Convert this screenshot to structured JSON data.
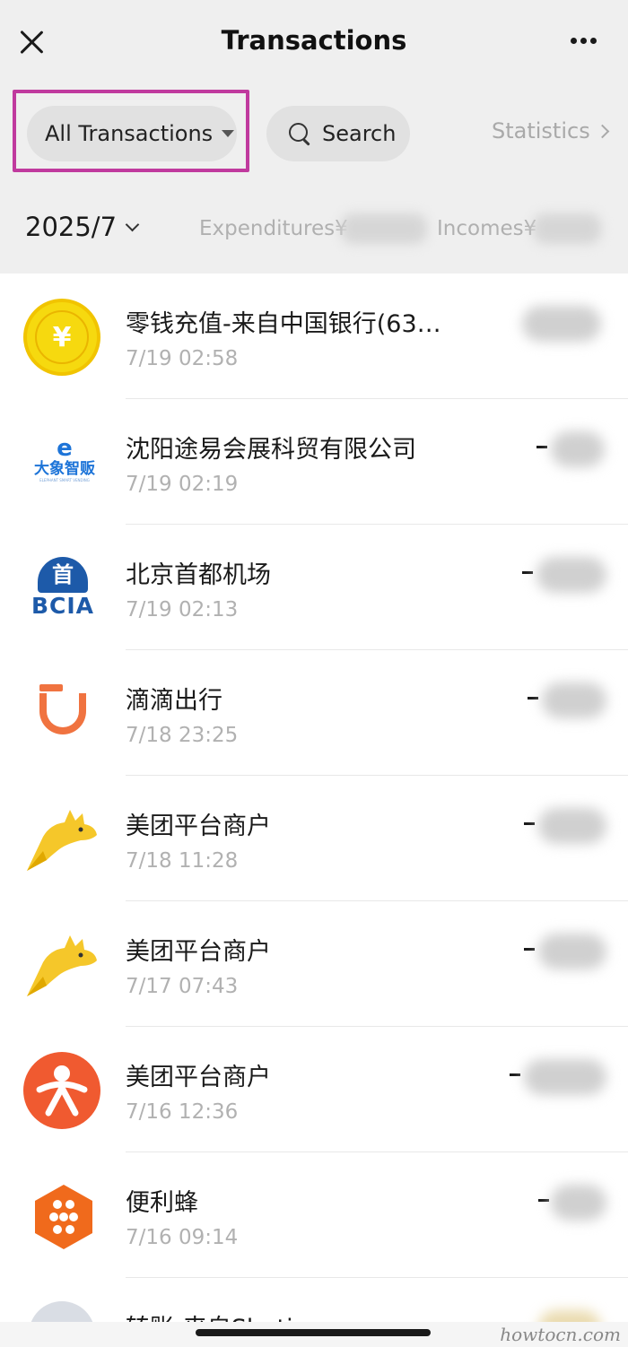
{
  "header": {
    "title": "Transactions",
    "close_icon": "close-icon",
    "more_icon": "more-dots-icon"
  },
  "filters": {
    "all_label": "All Transactions",
    "search_label": "Search",
    "statistics_label": "Statistics",
    "highlight_color": "#c03a9e"
  },
  "summary": {
    "month": "2025/7",
    "expenditures_label": "Expenditures¥",
    "incomes_label": "Incomes¥"
  },
  "transactions": [
    {
      "title": "零钱充值-来自中国银行(63…",
      "time": "7/19 02:58",
      "icon": "coin-yuan-icon"
    },
    {
      "title": "沈阳途易会展科贸有限公司",
      "time": "7/19 02:19",
      "icon": "daxiang-vending-logo"
    },
    {
      "title": "北京首都机场",
      "time": "7/19 02:13",
      "icon": "bcia-logo"
    },
    {
      "title": "滴滴出行",
      "time": "7/18 23:25",
      "icon": "didi-logo"
    },
    {
      "title": "美团平台商户",
      "time": "7/18 11:28",
      "icon": "meituan-kangaroo-logo"
    },
    {
      "title": "美团平台商户",
      "time": "7/17 07:43",
      "icon": "meituan-kangaroo-logo"
    },
    {
      "title": "美团平台商户",
      "time": "7/16 12:36",
      "icon": "dianping-logo"
    },
    {
      "title": "便利蜂",
      "time": "7/16 09:14",
      "icon": "bianlifeng-logo"
    },
    {
      "title": "转账-来自Shotie",
      "time": "",
      "icon": "avatar"
    }
  ],
  "logo_text": {
    "coin": "¥",
    "dx_mark": "e",
    "dx_name": "大象智贩",
    "dx_sub": "ELEPHANT SMART VENDING",
    "bcia_mark": "首",
    "bcia_name": "BCIA"
  },
  "watermark": "howtocn.com"
}
